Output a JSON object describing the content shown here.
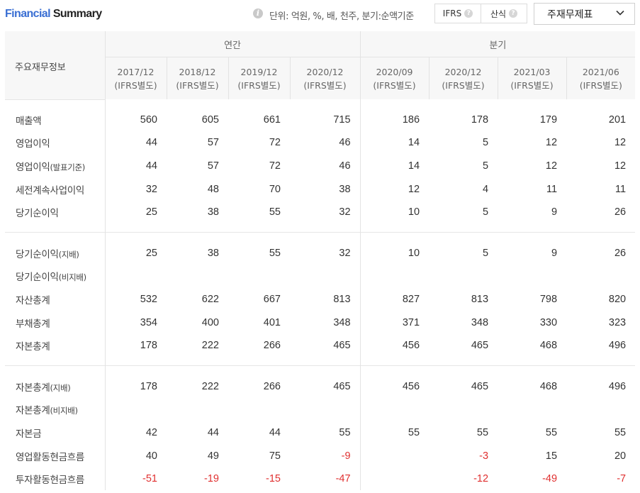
{
  "header": {
    "title_part1": "Financial",
    "title_part2": "Summary",
    "unit_text": "단위: 억원, %, 배, 천주, 분기:순액기준",
    "toggle": [
      {
        "label": "IFRS",
        "help": "?"
      },
      {
        "label": "산식",
        "help": "?"
      }
    ],
    "dropdown_label": "주재무제표"
  },
  "table": {
    "row_header": "주요재무정보",
    "group_annual": "연간",
    "group_quarter": "분기",
    "periods": [
      {
        "date": "2017/12",
        "basis": "(IFRS별도)"
      },
      {
        "date": "2018/12",
        "basis": "(IFRS별도)"
      },
      {
        "date": "2019/12",
        "basis": "(IFRS별도)"
      },
      {
        "date": "2020/12",
        "basis": "(IFRS별도)"
      },
      {
        "date": "2020/09",
        "basis": "(IFRS별도)"
      },
      {
        "date": "2020/12",
        "basis": "(IFRS별도)"
      },
      {
        "date": "2021/03",
        "basis": "(IFRS별도)"
      },
      {
        "date": "2021/06",
        "basis": "(IFRS별도)"
      }
    ],
    "sections": [
      [
        {
          "label": "매출액",
          "sub": "",
          "values": [
            "560",
            "605",
            "661",
            "715",
            "186",
            "178",
            "179",
            "201"
          ]
        },
        {
          "label": "영업이익",
          "sub": "",
          "values": [
            "44",
            "57",
            "72",
            "46",
            "14",
            "5",
            "12",
            "12"
          ]
        },
        {
          "label": "영업이익",
          "sub": "(발표기준)",
          "values": [
            "44",
            "57",
            "72",
            "46",
            "14",
            "5",
            "12",
            "12"
          ]
        },
        {
          "label": "세전계속사업이익",
          "sub": "",
          "values": [
            "32",
            "48",
            "70",
            "38",
            "12",
            "4",
            "11",
            "11"
          ]
        },
        {
          "label": "당기순이익",
          "sub": "",
          "values": [
            "25",
            "38",
            "55",
            "32",
            "10",
            "5",
            "9",
            "26"
          ]
        }
      ],
      [
        {
          "label": "당기순이익",
          "sub": "(지배)",
          "values": [
            "25",
            "38",
            "55",
            "32",
            "10",
            "5",
            "9",
            "26"
          ]
        },
        {
          "label": "당기순이익",
          "sub": "(비지배)",
          "values": [
            "",
            "",
            "",
            "",
            "",
            "",
            "",
            ""
          ]
        },
        {
          "label": "자산총계",
          "sub": "",
          "values": [
            "532",
            "622",
            "667",
            "813",
            "827",
            "813",
            "798",
            "820"
          ]
        },
        {
          "label": "부채총계",
          "sub": "",
          "values": [
            "354",
            "400",
            "401",
            "348",
            "371",
            "348",
            "330",
            "323"
          ]
        },
        {
          "label": "자본총계",
          "sub": "",
          "values": [
            "178",
            "222",
            "266",
            "465",
            "456",
            "465",
            "468",
            "496"
          ]
        }
      ],
      [
        {
          "label": "자본총계",
          "sub": "(지배)",
          "values": [
            "178",
            "222",
            "266",
            "465",
            "456",
            "465",
            "468",
            "496"
          ]
        },
        {
          "label": "자본총계",
          "sub": "(비지배)",
          "values": [
            "",
            "",
            "",
            "",
            "",
            "",
            "",
            ""
          ]
        },
        {
          "label": "자본금",
          "sub": "",
          "values": [
            "42",
            "44",
            "44",
            "55",
            "55",
            "55",
            "55",
            "55"
          ]
        },
        {
          "label": "영업활동현금흐름",
          "sub": "",
          "values": [
            "40",
            "49",
            "75",
            "-9",
            "",
            "-3",
            "15",
            "20"
          ]
        },
        {
          "label": "투자활동현금흐름",
          "sub": "",
          "values": [
            "-51",
            "-19",
            "-15",
            "-47",
            "",
            "-12",
            "-49",
            "-7"
          ]
        }
      ]
    ]
  },
  "colors": {
    "accent": "#3a6fd3",
    "negative": "#e03030",
    "header_bg": "#f7f7f7"
  }
}
